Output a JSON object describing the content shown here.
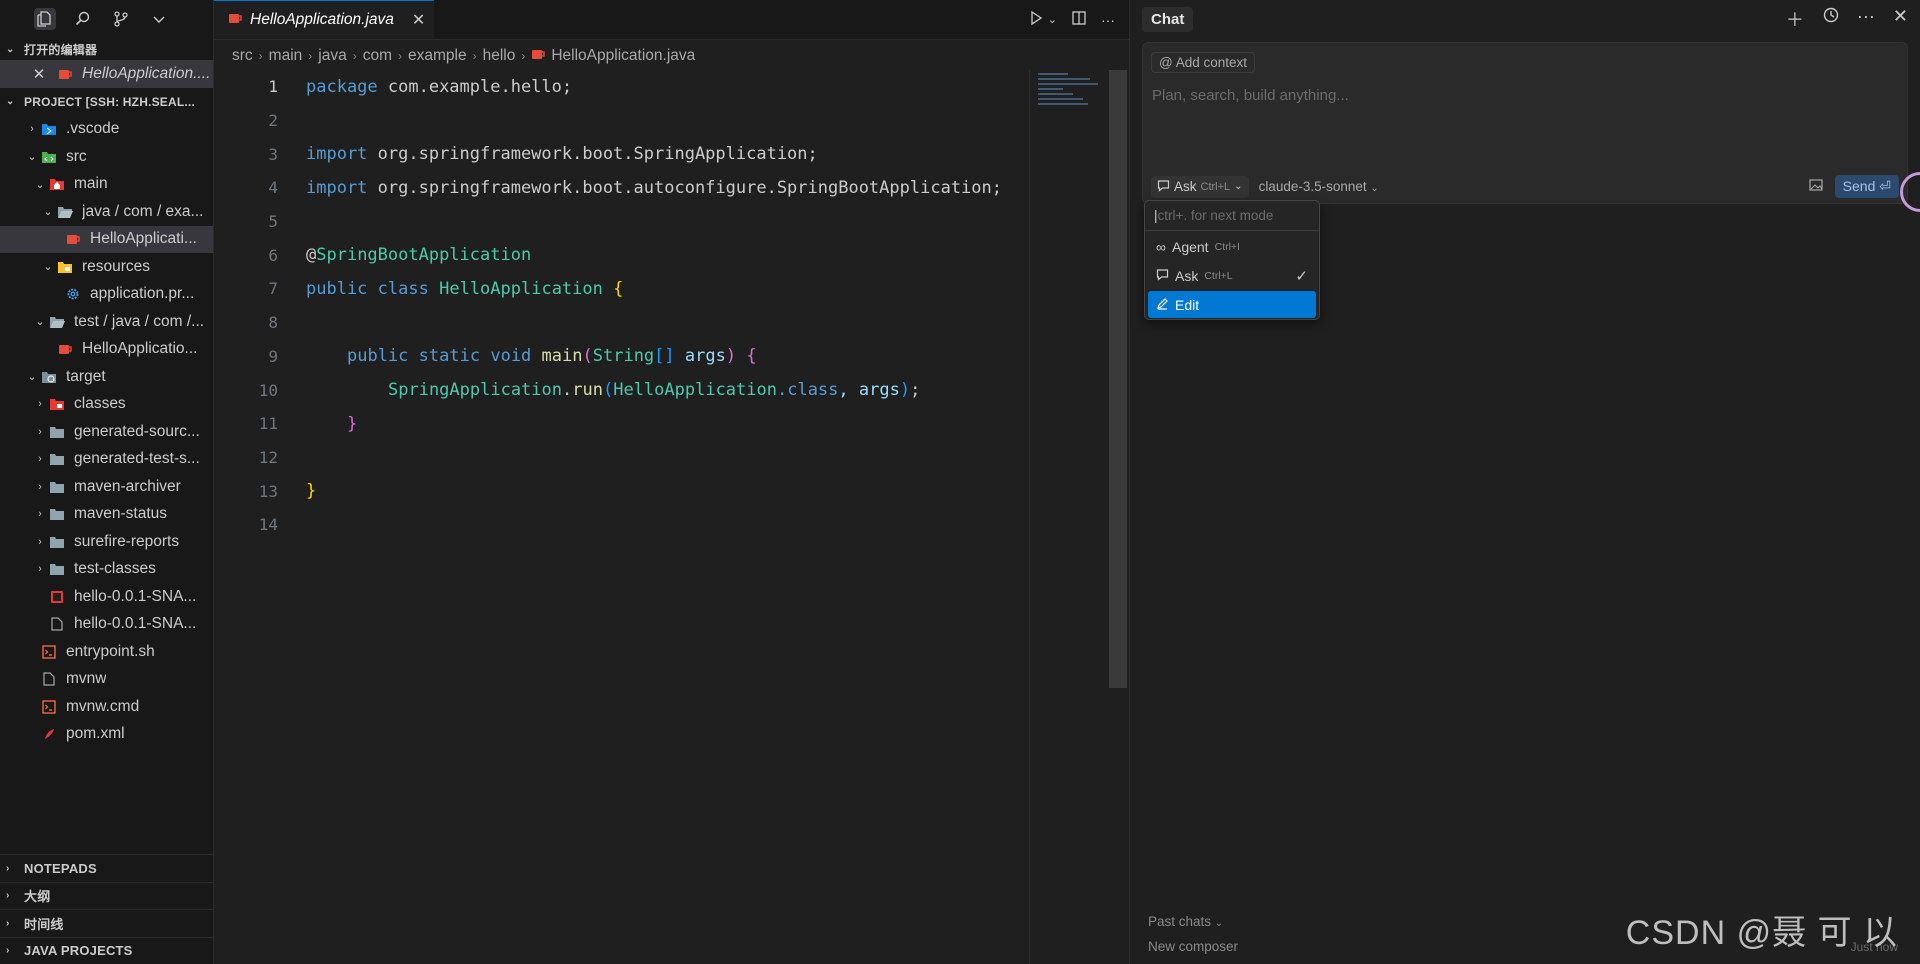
{
  "sidebar": {
    "open_editors_header": "打开的编辑器",
    "open_editor_file": "HelloApplication....",
    "project_header": "PROJECT [SSH: HZH.SEAL...",
    "tree": [
      {
        "label": ".vscode",
        "icon": "vscode-folder-icon",
        "chev": "›",
        "indent": 0
      },
      {
        "label": "src",
        "icon": "src-folder-icon",
        "chev": "⌄",
        "indent": 0
      },
      {
        "label": "main",
        "icon": "main-folder-icon",
        "chev": "⌄",
        "indent": 1
      },
      {
        "label": "java / com / exa...",
        "icon": "folder-open-icon",
        "chev": "⌄",
        "indent": 2
      },
      {
        "label": "HelloApplicati...",
        "icon": "java-file-icon",
        "chev": "",
        "indent": 3,
        "selected": true
      },
      {
        "label": "resources",
        "icon": "resources-folder-icon",
        "chev": "⌄",
        "indent": 2
      },
      {
        "label": "application.pr...",
        "icon": "settings-file-icon",
        "chev": "",
        "indent": 3
      },
      {
        "label": "test / java / com /...",
        "icon": "folder-open-icon",
        "chev": "⌄",
        "indent": 1
      },
      {
        "label": "HelloApplicatio...",
        "icon": "java-file-icon",
        "chev": "",
        "indent": 2
      },
      {
        "label": "target",
        "icon": "target-folder-icon",
        "chev": "⌄",
        "indent": 0
      },
      {
        "label": "classes",
        "icon": "classes-folder-icon",
        "chev": "›",
        "indent": 1
      },
      {
        "label": "generated-sourc...",
        "icon": "folder-icon",
        "chev": "›",
        "indent": 1
      },
      {
        "label": "generated-test-s...",
        "icon": "folder-icon",
        "chev": "›",
        "indent": 1
      },
      {
        "label": "maven-archiver",
        "icon": "folder-icon",
        "chev": "›",
        "indent": 1
      },
      {
        "label": "maven-status",
        "icon": "folder-icon",
        "chev": "›",
        "indent": 1
      },
      {
        "label": "surefire-reports",
        "icon": "folder-icon",
        "chev": "›",
        "indent": 1
      },
      {
        "label": "test-classes",
        "icon": "folder-icon",
        "chev": "›",
        "indent": 1
      },
      {
        "label": "hello-0.0.1-SNA...",
        "icon": "jar-file-icon",
        "chev": "",
        "indent": 1
      },
      {
        "label": "hello-0.0.1-SNA...",
        "icon": "file-icon",
        "chev": "",
        "indent": 1
      },
      {
        "label": "entrypoint.sh",
        "icon": "shell-file-icon",
        "chev": "",
        "indent": 0
      },
      {
        "label": "mvnw",
        "icon": "file-icon",
        "chev": "",
        "indent": 0
      },
      {
        "label": "mvnw.cmd",
        "icon": "shell-file-icon",
        "chev": "",
        "indent": 0
      },
      {
        "label": "pom.xml",
        "icon": "xml-file-icon",
        "chev": "",
        "indent": 0
      }
    ],
    "bottom_sections": [
      "NOTEPADS",
      "大纲",
      "时间线",
      "JAVA PROJECTS"
    ]
  },
  "editor": {
    "tab_label": "HelloApplication.java",
    "breadcrumb": [
      "src",
      "main",
      "java",
      "com",
      "example",
      "hello",
      "HelloApplication.java"
    ],
    "line_numbers": [
      "1",
      "2",
      "3",
      "4",
      "5",
      "6",
      "7",
      "8",
      "9",
      "10",
      "11",
      "12",
      "13",
      "14"
    ],
    "code": {
      "l1_kw": "package",
      "l1_rest": " com.example.hello;",
      "l3_kw": "import",
      "l3_rest": " org.springframework.boot.SpringApplication;",
      "l4_kw": "import",
      "l4_rest": " org.springframework.boot.autoconfigure.SpringBootApplication;",
      "l6_at": "@",
      "l6_ann": "SpringBootApplication",
      "l7_kw1": "public",
      "l7_kw2": "class",
      "l7_type": "HelloApplication",
      "l7_brace": "{",
      "l9_kw1": "public",
      "l9_kw2": "static",
      "l9_kw3": "void",
      "l9_fn": "main",
      "l9_p1": "(",
      "l9_type": "String",
      "l9_arr": "[]",
      "l9_param": "args",
      "l9_p2": ")",
      "l9_brace": "{",
      "l10_type": "SpringApplication",
      "l10_dot": ".",
      "l10_fn": "run",
      "l10_p1": "(",
      "l10_type2": "HelloApplication",
      "l10_cls": ".class",
      "l10_sep": ", args",
      "l10_p2": ")",
      "l10_end": ";",
      "l11_brace": "}",
      "l13_brace": "}"
    }
  },
  "chat": {
    "title": "Chat",
    "add_context": "Add context",
    "placeholder": "Plan, search, build anything...",
    "mode_label": "Ask",
    "mode_shortcut": "Ctrl+L",
    "model": "claude-3.5-sonnet",
    "send_label": "Send",
    "dropdown": {
      "search_placeholder": "ctrl+. for next mode",
      "items": [
        {
          "label": "Agent",
          "shortcut": "Ctrl+I"
        },
        {
          "label": "Ask",
          "shortcut": "Ctrl+L",
          "checked": true
        },
        {
          "label": "Edit",
          "shortcut": ""
        }
      ]
    },
    "past_chats": "Past chats",
    "new_composer": "New composer",
    "timestamp": "Just now"
  },
  "watermark": "CSDN @聂 可 以",
  "colors": {
    "accent": "#0078d4",
    "background": "#1f1f1f",
    "sidebar": "#181818"
  }
}
